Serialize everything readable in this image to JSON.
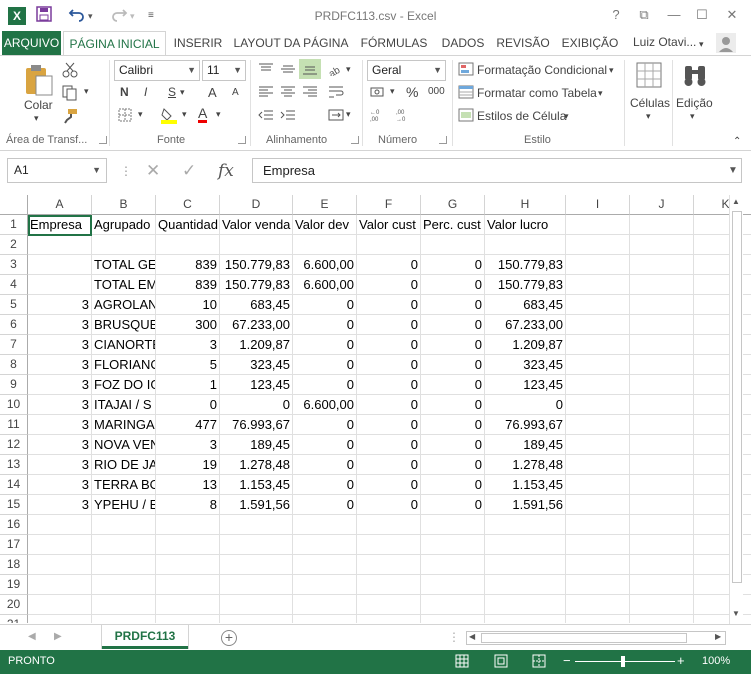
{
  "window": {
    "title": "PRDFC113.csv - Excel",
    "help": "?",
    "restore_ribbon": "⧉",
    "minimize": "—",
    "maximize": "☐",
    "close": "✕"
  },
  "qat": {
    "app_icon": "X",
    "save_icon": "save-icon",
    "undo_icon": "undo-icon",
    "redo_icon": "redo-icon"
  },
  "tabs": [
    {
      "label": "ARQUIVO"
    },
    {
      "label": "PÁGINA INICIAL"
    },
    {
      "label": "INSERIR"
    },
    {
      "label": "LAYOUT DA PÁGINA"
    },
    {
      "label": "FÓRMULAS"
    },
    {
      "label": "DADOS"
    },
    {
      "label": "REVISÃO"
    },
    {
      "label": "EXIBIÇÃO"
    }
  ],
  "user": "Luiz Otavi...",
  "ribbon": {
    "clipboard": {
      "paste_label": "Colar",
      "group_label": "Área de Transf..."
    },
    "font": {
      "name": "Calibri",
      "size": "11",
      "bold": "N",
      "italic": "I",
      "underline": "S",
      "grow": "A",
      "shrink": "A",
      "font_color": "A",
      "group_label": "Fonte"
    },
    "alignment": {
      "group_label": "Alinhamento"
    },
    "number": {
      "format": "Geral",
      "percent": "%",
      "thousands": "000",
      "group_label": "Número"
    },
    "styles": {
      "conditional": "Formatação Condicional",
      "as_table": "Formatar como Tabela",
      "cell_styles": "Estilos de Célula",
      "group_label": "Estilo"
    },
    "cells": {
      "label": "Células"
    },
    "editing": {
      "label": "Edição"
    }
  },
  "formula_bar": {
    "name_box": "A1",
    "fx": "fx",
    "content": "Empresa"
  },
  "grid": {
    "columns": [
      "A",
      "B",
      "C",
      "D",
      "E",
      "F",
      "G",
      "H",
      "I",
      "J",
      "K"
    ],
    "rows": [
      [
        "Empresa",
        "Agrupado",
        "Quantidad",
        "Valor venda",
        "Valor dev",
        "Valor cust",
        "Perc. cust",
        "Valor lucro"
      ],
      [
        "",
        "",
        "",
        "",
        "",
        "",
        "",
        ""
      ],
      [
        "",
        "TOTAL GE",
        "839",
        "150.779,83",
        "6.600,00",
        "0",
        "0",
        "150.779,83"
      ],
      [
        "",
        "TOTAL EM",
        "839",
        "150.779,83",
        "6.600,00",
        "0",
        "0",
        "150.779,83"
      ],
      [
        "3",
        "AGROLAN",
        "10",
        "683,45",
        "0",
        "0",
        "0",
        "683,45"
      ],
      [
        "3",
        "BRUSQUE",
        "300",
        "67.233,00",
        "0",
        "0",
        "0",
        "67.233,00"
      ],
      [
        "3",
        "CIANORTE",
        "3",
        "1.209,87",
        "0",
        "0",
        "0",
        "1.209,87"
      ],
      [
        "3",
        "FLORIANC",
        "5",
        "323,45",
        "0",
        "0",
        "0",
        "323,45"
      ],
      [
        "3",
        "FOZ DO IG",
        "1",
        "123,45",
        "0",
        "0",
        "0",
        "123,45"
      ],
      [
        "3",
        "ITAJAI / S",
        "0",
        "0",
        "6.600,00",
        "0",
        "0",
        "0"
      ],
      [
        "3",
        "MARINGA",
        "477",
        "76.993,67",
        "0",
        "0",
        "0",
        "76.993,67"
      ],
      [
        "3",
        "NOVA VEN",
        "3",
        "189,45",
        "0",
        "0",
        "0",
        "189,45"
      ],
      [
        "3",
        "RIO DE JAI",
        "19",
        "1.278,48",
        "0",
        "0",
        "0",
        "1.278,48"
      ],
      [
        "3",
        "TERRA BO",
        "13",
        "1.153,45",
        "0",
        "0",
        "0",
        "1.153,45"
      ],
      [
        "3",
        "YPEHU / E",
        "8",
        "1.591,56",
        "0",
        "0",
        "0",
        "1.591,56"
      ],
      [
        "",
        "",
        "",
        "",
        "",
        "",
        "",
        ""
      ],
      [
        "",
        "",
        "",
        "",
        "",
        "",
        "",
        ""
      ],
      [
        "",
        "",
        "",
        "",
        "",
        "",
        "",
        ""
      ],
      [
        "",
        "",
        "",
        "",
        "",
        "",
        "",
        ""
      ],
      [
        "",
        "",
        "",
        "",
        "",
        "",
        "",
        ""
      ],
      [
        "",
        "",
        "",
        "",
        "",
        "",
        "",
        ""
      ]
    ],
    "row_numbers": [
      "1",
      "2",
      "3",
      "4",
      "5",
      "6",
      "7",
      "8",
      "9",
      "10",
      "11",
      "12",
      "13",
      "14",
      "15",
      "16",
      "17",
      "18",
      "19",
      "20",
      "21"
    ]
  },
  "sheet": {
    "name": "PRDFC113",
    "add": "+"
  },
  "status": {
    "mode": "PRONTO",
    "zoom": "100%",
    "zoom_out": "−",
    "zoom_in": "+"
  },
  "colors": {
    "accent": "#217346",
    "grid_line": "#e0e0e0"
  }
}
